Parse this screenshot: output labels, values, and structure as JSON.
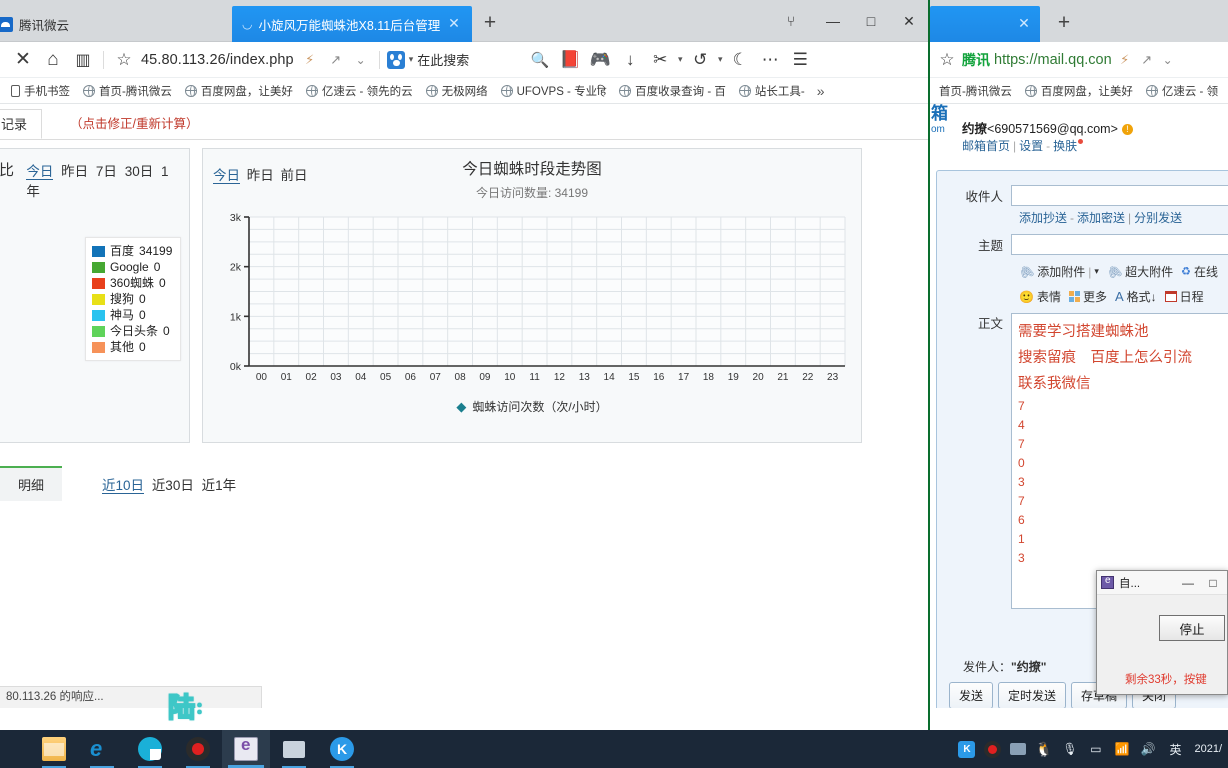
{
  "left_browser": {
    "tabs": [
      {
        "title": "腾讯微云",
        "active": false
      },
      {
        "title": "小旋风万能蜘蛛池X8.11后台管理",
        "active": true
      }
    ],
    "new_tab_label": "+",
    "window_controls": {
      "extensions": "⑂",
      "minimize": "—",
      "maximize": "□",
      "close": "✕"
    },
    "toolbar": {
      "stop_label": "✕",
      "home_label": "⌂",
      "reader_label": "▥",
      "star_label": "☆",
      "url": "45.80.113.26/index.php",
      "url_suffix": "",
      "lightning_label": "⚡",
      "share_label": "↗",
      "chevron_label": "⌄",
      "search_engine": "baidu-icon",
      "search_placeholder": "在此搜索",
      "search_label": "🔍",
      "favorites_label": "📕",
      "game_label": "🎮",
      "download_label": "↓",
      "cut_label": "✂",
      "history_label": "↺",
      "night_label": "☾",
      "more_label": "⋯",
      "menu_label": "☰"
    },
    "bookmarks": [
      {
        "label": "手机书签",
        "icon": "phone-icon"
      },
      {
        "label": "首页-腾讯微云",
        "icon": "globe-icon"
      },
      {
        "label": "百度网盘，让美好",
        "icon": "globe-icon"
      },
      {
        "label": "亿速云 - 领先的云",
        "icon": "globe-icon"
      },
      {
        "label": "无极网络",
        "icon": "globe-icon"
      },
      {
        "label": "UFOVPS - 专业हि",
        "icon": "globe-icon"
      },
      {
        "label": "百度收录查询 - 百",
        "icon": "globe-icon"
      },
      {
        "label": "站长工具-",
        "icon": "globe-icon"
      }
    ],
    "bookmarks_overflow": "»"
  },
  "page": {
    "tab_label": "记录",
    "recalc_label": "（点击修正/重新计算）",
    "left_panel": {
      "title": "访问比率",
      "ranges": [
        {
          "label": "今日",
          "active": true
        },
        {
          "label": "昨日",
          "active": false
        },
        {
          "label": "7日",
          "active": false
        },
        {
          "label": "30日",
          "active": false
        },
        {
          "label": "1年",
          "active": false
        }
      ],
      "legend": [
        {
          "name": "百度",
          "value": "34199",
          "color": "#1273b8"
        },
        {
          "name": "Google",
          "value": "0",
          "color": "#46a832"
        },
        {
          "name": "360蜘蛛",
          "value": "0",
          "color": "#e8401c"
        },
        {
          "name": "搜狗",
          "value": "0",
          "color": "#e8e017"
        },
        {
          "name": "神马",
          "value": "0",
          "color": "#29c3ef"
        },
        {
          "name": "今日头条",
          "value": "0",
          "color": "#5fd35a"
        },
        {
          "name": "其他",
          "value": "0",
          "color": "#f69259"
        }
      ]
    },
    "chart_panel": {
      "ranges": [
        {
          "label": "今日",
          "active": true
        },
        {
          "label": "昨日",
          "active": false
        },
        {
          "label": "前日",
          "active": false
        }
      ]
    },
    "detail": {
      "tab_label": "明细",
      "ranges": [
        {
          "label": "近10日",
          "active": true
        },
        {
          "label": "近30日",
          "active": false
        },
        {
          "label": "近1年",
          "active": false
        }
      ]
    },
    "status_text": "80.113.26 的响应..."
  },
  "chart_data": {
    "type": "line",
    "title": "今日蜘蛛时段走势图",
    "subtitle": "今日访问数量: 34199",
    "xlabel": "",
    "ylabel": "",
    "categories": [
      "00",
      "01",
      "02",
      "03",
      "04",
      "05",
      "06",
      "07",
      "08",
      "09",
      "10",
      "11",
      "12",
      "13",
      "14",
      "15",
      "16",
      "17",
      "18",
      "19",
      "20",
      "21",
      "22",
      "23"
    ],
    "ytick_labels": [
      "0k",
      "1k",
      "2k",
      "3k"
    ],
    "ylim": [
      0,
      3000
    ],
    "grid": true,
    "legend_position": "bottom",
    "series": [
      {
        "name": "蜘蛛访问次数（次/小时）",
        "color": "#1a7f8e",
        "values": [
          null,
          null,
          null,
          null,
          null,
          null,
          null,
          null,
          null,
          null,
          null,
          null,
          null,
          null,
          null,
          null,
          null,
          null,
          null,
          null,
          null,
          null,
          null,
          null
        ]
      }
    ],
    "legend_label": "蜘蛛访问次数（次/小时）"
  },
  "right_browser": {
    "tab_title": "",
    "new_tab_label": "+",
    "toolbar": {
      "star_label": "☆",
      "brand": "腾讯",
      "url": "https://mail.qq.con",
      "lightning_label": "⚡",
      "share_label": "↗",
      "chevron_label": "⌄"
    },
    "bookmarks": [
      {
        "label": "首页-腾讯微云",
        "icon": "globe-icon"
      },
      {
        "label": "百度网盘，让美好",
        "icon": "globe-icon"
      },
      {
        "label": "亿速云 - 领",
        "icon": "globe-icon"
      }
    ]
  },
  "mail": {
    "logo_cn": "箱",
    "logo_com": "om",
    "account": "约撩",
    "account_email": "<690571569@qq.com>",
    "warn_badge": "!",
    "links": {
      "home": "邮箱首页",
      "settings": "设置",
      "skin": "换肤"
    },
    "compose": {
      "to_label": "收件人",
      "to_value": "",
      "cc_label": "添加抄送",
      "bcc_label": "添加密送",
      "separate_label": "分别发送",
      "subject_label": "主题",
      "subject_value": "",
      "tools": [
        {
          "label": "添加附件",
          "icon": "paperclip-icon"
        },
        {
          "label": "▾",
          "icon": "chevron-down-icon"
        },
        {
          "label": "超大附件",
          "icon": "paperclip-icon"
        },
        {
          "label": "在线",
          "icon": "online-doc-icon"
        },
        {
          "label": "表情",
          "icon": "emoji-icon"
        },
        {
          "label": "更多",
          "icon": "grid-icon"
        },
        {
          "label": "格式↓",
          "icon": "format-icon"
        },
        {
          "label": "日程",
          "icon": "calendar-icon"
        }
      ],
      "body_label": "正文",
      "body_lines": [
        "需要学习搭建蜘蛛池",
        "搜索留痕　百度上怎么引流",
        "联系我微信"
      ],
      "body_digits": [
        "7",
        "4",
        "7",
        "0",
        "3",
        "7",
        "6",
        "1",
        "3"
      ],
      "sender_label": "发件人：",
      "sender_value": "\"约撩\"",
      "buttons": [
        "发送",
        "定时发送",
        "存草稿",
        "关闭"
      ]
    }
  },
  "mini_dialog": {
    "title": "自...",
    "minimize_label": "—",
    "maximize_label": "□",
    "stop_label": "停止",
    "message": "剩余33秒，按键"
  },
  "watermark": {
    "text": "陆",
    "suffix": "："
  },
  "taskbar": {
    "apps": [
      {
        "name": "file-explorer",
        "icon": "folder-icon",
        "state": "open"
      },
      {
        "name": "internet-explorer",
        "icon": "ie-icon",
        "state": "open"
      },
      {
        "name": "qq-browser",
        "icon": "qq-browser-icon",
        "state": "open"
      },
      {
        "name": "screen-recorder",
        "icon": "record-icon",
        "state": "open"
      },
      {
        "name": "edge-legacy",
        "icon": "edge-icon",
        "state": "active"
      },
      {
        "name": "remote-desktop",
        "icon": "monitor-icon",
        "state": "open"
      },
      {
        "name": "kingsoft",
        "icon": "k-icon",
        "state": "open"
      }
    ],
    "tray": [
      {
        "name": "kingsoft-tray",
        "icon": "k-icon"
      },
      {
        "name": "record-tray",
        "icon": "record-icon"
      },
      {
        "name": "screen-tray",
        "icon": "screen-icon"
      },
      {
        "name": "qq-tray",
        "icon": "penguin-icon"
      },
      {
        "name": "mic-tray",
        "icon": "mic-icon"
      },
      {
        "name": "battery-tray",
        "icon": "battery-icon"
      },
      {
        "name": "wifi-tray",
        "icon": "wifi-icon"
      },
      {
        "name": "volume-tray",
        "icon": "speaker-icon"
      },
      {
        "name": "ime-tray",
        "icon": "ime-icon",
        "label": "英"
      }
    ],
    "clock": "2021/"
  }
}
